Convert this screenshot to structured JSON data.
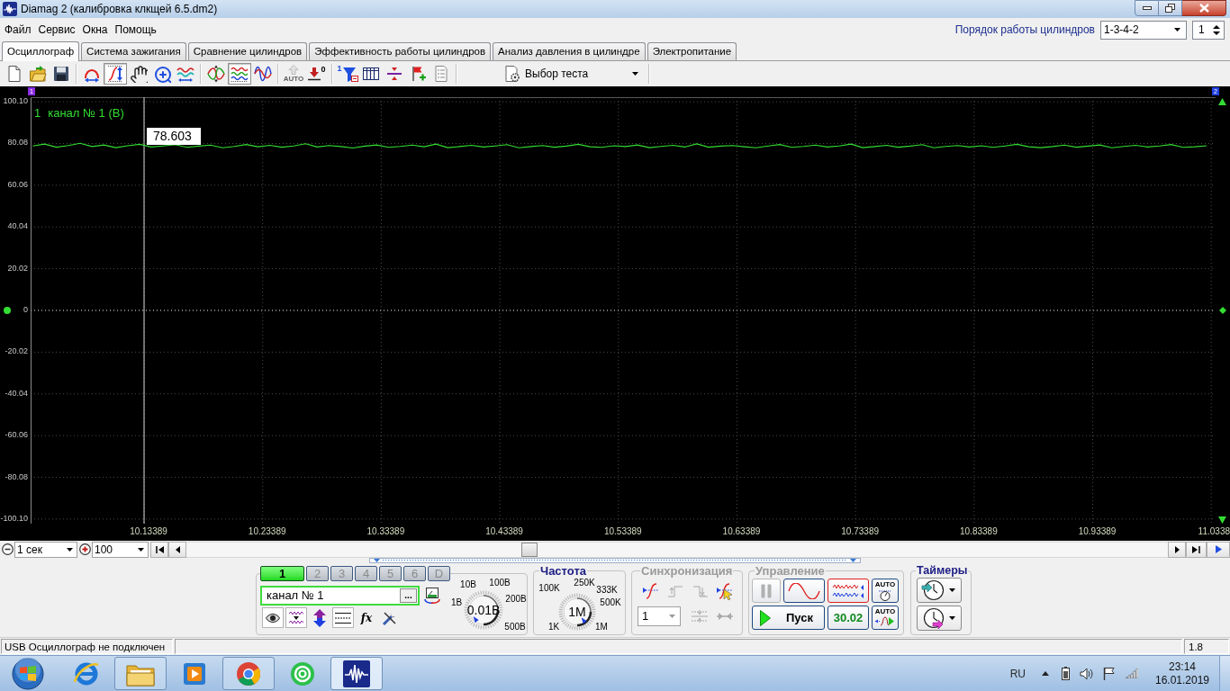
{
  "window": {
    "title": "Diamag 2 (калибровка клкщей 6.5.dm2)"
  },
  "menu": [
    "Файл",
    "Сервис",
    "Окна",
    "Помощь"
  ],
  "cylinder_order": {
    "label": "Порядок работы цилиндров",
    "value": "1-3-4-2",
    "cylinder": "1"
  },
  "tabs": [
    {
      "label": "Осциллограф",
      "selected": true
    },
    {
      "label": "Система зажигания",
      "selected": false
    },
    {
      "label": "Сравнение цилиндров",
      "selected": false
    },
    {
      "label": "Эффективность работы цилиндров",
      "selected": false
    },
    {
      "label": "Анализ давления в цилиндре",
      "selected": false
    },
    {
      "label": "Электропитание",
      "selected": false
    }
  ],
  "toolbar": {
    "groups": [
      [
        {
          "pressed": false,
          "disabled": false
        },
        {
          "pressed": false,
          "disabled": false
        },
        {
          "pressed": false,
          "disabled": false
        }
      ],
      [
        {
          "pressed": false,
          "disabled": false
        },
        {
          "pressed": true,
          "disabled": false
        },
        {
          "pressed": false,
          "disabled": false
        },
        {
          "pressed": false,
          "disabled": false
        },
        {
          "pressed": false,
          "disabled": false
        }
      ],
      [
        {
          "pressed": false,
          "disabled": false
        },
        {
          "pressed": true,
          "disabled": false
        },
        {
          "pressed": false,
          "disabled": false
        }
      ],
      [
        {
          "pressed": false,
          "disabled": true,
          "label": "AUTO"
        },
        {
          "pressed": false,
          "disabled": false,
          "label": "0"
        }
      ],
      [
        {
          "pressed": false,
          "disabled": false,
          "label": "1"
        },
        {
          "pressed": false,
          "disabled": false
        },
        {
          "pressed": false,
          "disabled": false
        },
        {
          "pressed": false,
          "disabled": false
        },
        {
          "pressed": false,
          "disabled": false
        }
      ]
    ],
    "test_select": "Выбор теста"
  },
  "oscilloscope": {
    "markers": [
      "1",
      "2"
    ],
    "channel_number": "1",
    "chart_data": {
      "type": "line",
      "x": [
        10.04,
        10.05,
        10.06,
        10.07,
        10.08,
        10.09,
        10.1,
        10.11,
        10.12,
        10.13,
        10.14,
        10.15,
        10.16,
        10.17,
        10.18,
        10.19,
        10.2,
        10.21,
        10.22,
        10.23,
        10.24,
        10.25,
        10.26,
        10.27,
        10.28,
        10.29,
        10.3,
        10.31,
        10.32,
        10.33,
        10.34,
        10.35,
        10.36,
        10.37,
        10.38,
        10.39,
        10.4,
        10.41,
        10.42,
        10.43,
        10.44,
        10.45,
        10.46,
        10.47,
        10.48,
        10.49,
        10.5,
        10.51,
        10.52,
        10.53,
        10.54,
        10.55,
        10.56,
        10.57,
        10.58,
        10.59,
        10.6,
        10.61,
        10.62,
        10.63,
        10.64,
        10.65,
        10.66,
        10.67,
        10.68,
        10.69,
        10.7,
        10.71,
        10.72,
        10.73,
        10.74,
        10.75,
        10.76,
        10.77,
        10.78,
        10.79,
        10.8,
        10.81,
        10.82,
        10.83,
        10.84,
        10.85,
        10.86,
        10.87,
        10.88,
        10.89,
        10.9,
        10.91,
        10.92,
        10.93,
        10.94,
        10.95,
        10.96,
        10.97,
        10.98,
        10.99,
        11,
        11.01,
        11.02,
        11.03
      ],
      "series": [
        {
          "name": "канал № 1 (В)",
          "color": "#33dd33",
          "values": [
            78.9,
            79.8,
            78.3,
            79.1,
            80.2,
            78.6,
            79.4,
            78.1,
            79.0,
            79.7,
            78.4,
            78.9,
            79.5,
            78.2,
            78.8,
            79.3,
            78.0,
            78.7,
            79.6,
            78.5,
            79.2,
            78.3,
            78.9,
            80.0,
            78.4,
            79.1,
            78.6,
            77.9,
            78.8,
            79.4,
            78.2,
            78.7,
            79.3,
            78.5,
            79.8,
            78.1,
            78.6,
            79.2,
            78.4,
            78.9,
            79.5,
            78.0,
            78.6,
            79.1,
            78.3,
            78.8,
            79.7,
            78.5,
            78.2,
            79.0,
            78.6,
            79.4,
            78.1,
            78.7,
            79.2,
            78.4,
            79.9,
            78.3,
            78.8,
            79.1,
            78.5,
            78.0,
            78.9,
            79.6,
            78.2,
            78.7,
            79.3,
            78.4,
            78.9,
            79.8,
            78.1,
            78.6,
            79.2,
            78.3,
            78.8,
            79.5,
            78.0,
            78.7,
            79.1,
            78.4,
            79.0,
            78.2,
            78.9,
            79.7,
            78.5,
            78.1,
            78.6,
            79.3,
            78.3,
            78.8,
            79.4,
            78.0,
            78.7,
            79.2,
            78.4,
            78.9,
            79.6,
            78.2,
            78.5,
            79.0
          ]
        }
      ],
      "xlim": [
        10.0382,
        11.0375
      ],
      "ylim": [
        -102.3,
        102.3
      ],
      "xticks": [
        10.13389,
        10.23389,
        10.33389,
        10.43389,
        10.53389,
        10.63389,
        10.73389,
        10.83389,
        10.93389,
        11.0338
      ],
      "yticks": [
        {
          "value": 100.1,
          "label": "100.10"
        },
        80.08,
        60.06,
        40.04,
        20.02,
        0,
        -20.02,
        -40.04,
        -60.06,
        -80.08,
        {
          "value": -100.1,
          "label": "-100.10"
        }
      ],
      "grid": true,
      "ref_lines": [
        {
          "axis": "y",
          "value": 0
        },
        {
          "axis": "x",
          "value": 10.13389
        }
      ],
      "annotations": [
        {
          "x": 10.13389,
          "y": 78.603,
          "text": "78.603"
        }
      ]
    }
  },
  "time_controls": {
    "time_scale": "1 сек",
    "amplitude": "100"
  },
  "channel_panel": {
    "channels": [
      {
        "label": "1",
        "selected": true
      },
      {
        "label": "2",
        "selected": false
      },
      {
        "label": "3",
        "selected": false
      },
      {
        "label": "4",
        "selected": false
      },
      {
        "label": "5",
        "selected": false
      },
      {
        "label": "6",
        "selected": false
      },
      {
        "label": "D",
        "selected": false
      }
    ],
    "name": "канал № 1",
    "browse": "...",
    "tools": [
      {
        "pressed": true
      },
      {
        "pressed": true
      },
      {
        "pressed": false
      },
      {
        "pressed": true
      },
      {
        "pressed": false,
        "label": "fx"
      },
      {
        "pressed": false
      }
    ],
    "voltage_knob": {
      "labels": [
        "10В",
        "100В",
        "1В",
        "200В",
        "500В"
      ],
      "value": "0.01В"
    }
  },
  "frequency": {
    "title": "Частота",
    "disabled": false,
    "labels": [
      "250K",
      "100K",
      "333K",
      "500K",
      "1K",
      "1M"
    ],
    "value": "1M"
  },
  "sync": {
    "title": "Синхронизация",
    "disabled": true,
    "buttons": [
      {
        "disabled": false
      },
      {
        "disabled": true
      },
      {
        "disabled": true
      },
      {
        "disabled": false
      },
      {
        "disabled": true
      },
      {
        "disabled": true
      }
    ],
    "channel": "1"
  },
  "control": {
    "title": "Управление",
    "disabled": true,
    "pause_disabled": true,
    "modes": [
      {
        "selected": false
      },
      {
        "selected": true
      }
    ],
    "auto_labels": [
      "AUTO",
      "AUTO"
    ],
    "start": "Пуск",
    "rate": "30.02"
  },
  "timers": {
    "title": "Таймеры",
    "disabled": false
  },
  "status_bar": {
    "message": "USB Осциллограф не подключен",
    "field_3": "1.8"
  },
  "taskbar": {
    "apps": [
      {
        "running": false,
        "active": false
      },
      {
        "running": true,
        "active": false
      },
      {
        "running": false,
        "active": false
      },
      {
        "running": true,
        "active": false
      },
      {
        "running": false,
        "active": false
      },
      {
        "running": true,
        "active": true
      }
    ],
    "language": "RU",
    "time": "23:14",
    "date": "16.01.2019"
  }
}
